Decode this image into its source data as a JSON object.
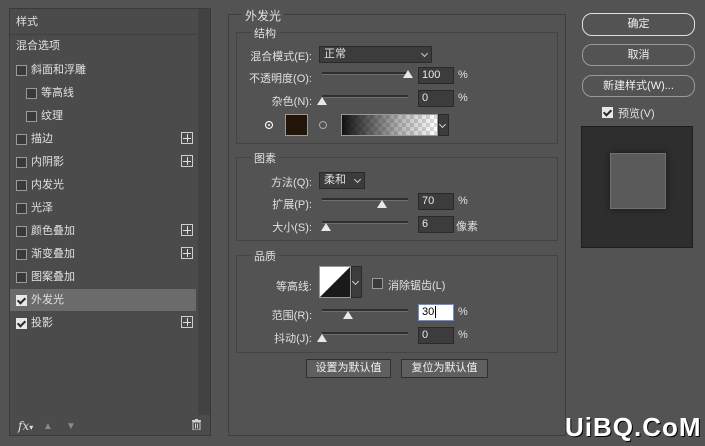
{
  "left_panel": {
    "header": "样式",
    "blend_options": "混合选项",
    "items": [
      {
        "label": "斜面和浮雕",
        "checked": false,
        "plus": false,
        "indent": false
      },
      {
        "label": "等高线",
        "checked": false,
        "plus": false,
        "indent": true
      },
      {
        "label": "纹理",
        "checked": false,
        "plus": false,
        "indent": true
      },
      {
        "label": "描边",
        "checked": false,
        "plus": true,
        "indent": false
      },
      {
        "label": "内阴影",
        "checked": false,
        "plus": true,
        "indent": false
      },
      {
        "label": "内发光",
        "checked": false,
        "plus": false,
        "indent": false
      },
      {
        "label": "光泽",
        "checked": false,
        "plus": false,
        "indent": false
      },
      {
        "label": "颜色叠加",
        "checked": false,
        "plus": true,
        "indent": false
      },
      {
        "label": "渐变叠加",
        "checked": false,
        "plus": true,
        "indent": false
      },
      {
        "label": "图案叠加",
        "checked": false,
        "plus": false,
        "indent": false
      },
      {
        "label": "外发光",
        "checked": true,
        "plus": false,
        "indent": false,
        "selected": true
      },
      {
        "label": "投影",
        "checked": true,
        "plus": true,
        "indent": false
      }
    ],
    "footer": {
      "fx": "fx"
    }
  },
  "main": {
    "title": "外发光",
    "structure": {
      "title": "结构",
      "blend_mode_label": "混合模式(E):",
      "blend_mode_value": "正常",
      "opacity_label": "不透明度(O):",
      "opacity_value": "100",
      "opacity_fraction": 1.0,
      "noise_label": "杂色(N):",
      "noise_value": "0",
      "noise_fraction": 0.0,
      "unit": "%",
      "glow_color": "#221508"
    },
    "elements": {
      "title": "图素",
      "method_label": "方法(Q):",
      "method_value": "柔和",
      "spread_label": "扩展(P):",
      "spread_value": "70",
      "spread_fraction": 0.7,
      "size_label": "大小(S):",
      "size_value": "6",
      "size_fraction": 0.05,
      "size_unit": "像素",
      "unit": "%"
    },
    "quality": {
      "title": "品质",
      "contour_label": "等高线:",
      "antialias_label": "消除锯齿(L)",
      "range_label": "范围(R):",
      "range_value": "30",
      "range_fraction": 0.3,
      "jitter_label": "抖动(J):",
      "jitter_value": "0",
      "jitter_fraction": 0.0,
      "unit": "%"
    },
    "buttons": {
      "set_default": "设置为默认值",
      "reset_default": "复位为默认值"
    }
  },
  "right": {
    "ok": "确定",
    "cancel": "取消",
    "new_style": "新建样式(W)...",
    "preview_label": "预览(V)",
    "preview_checked": true
  },
  "watermark": "UiBQ.CoM"
}
